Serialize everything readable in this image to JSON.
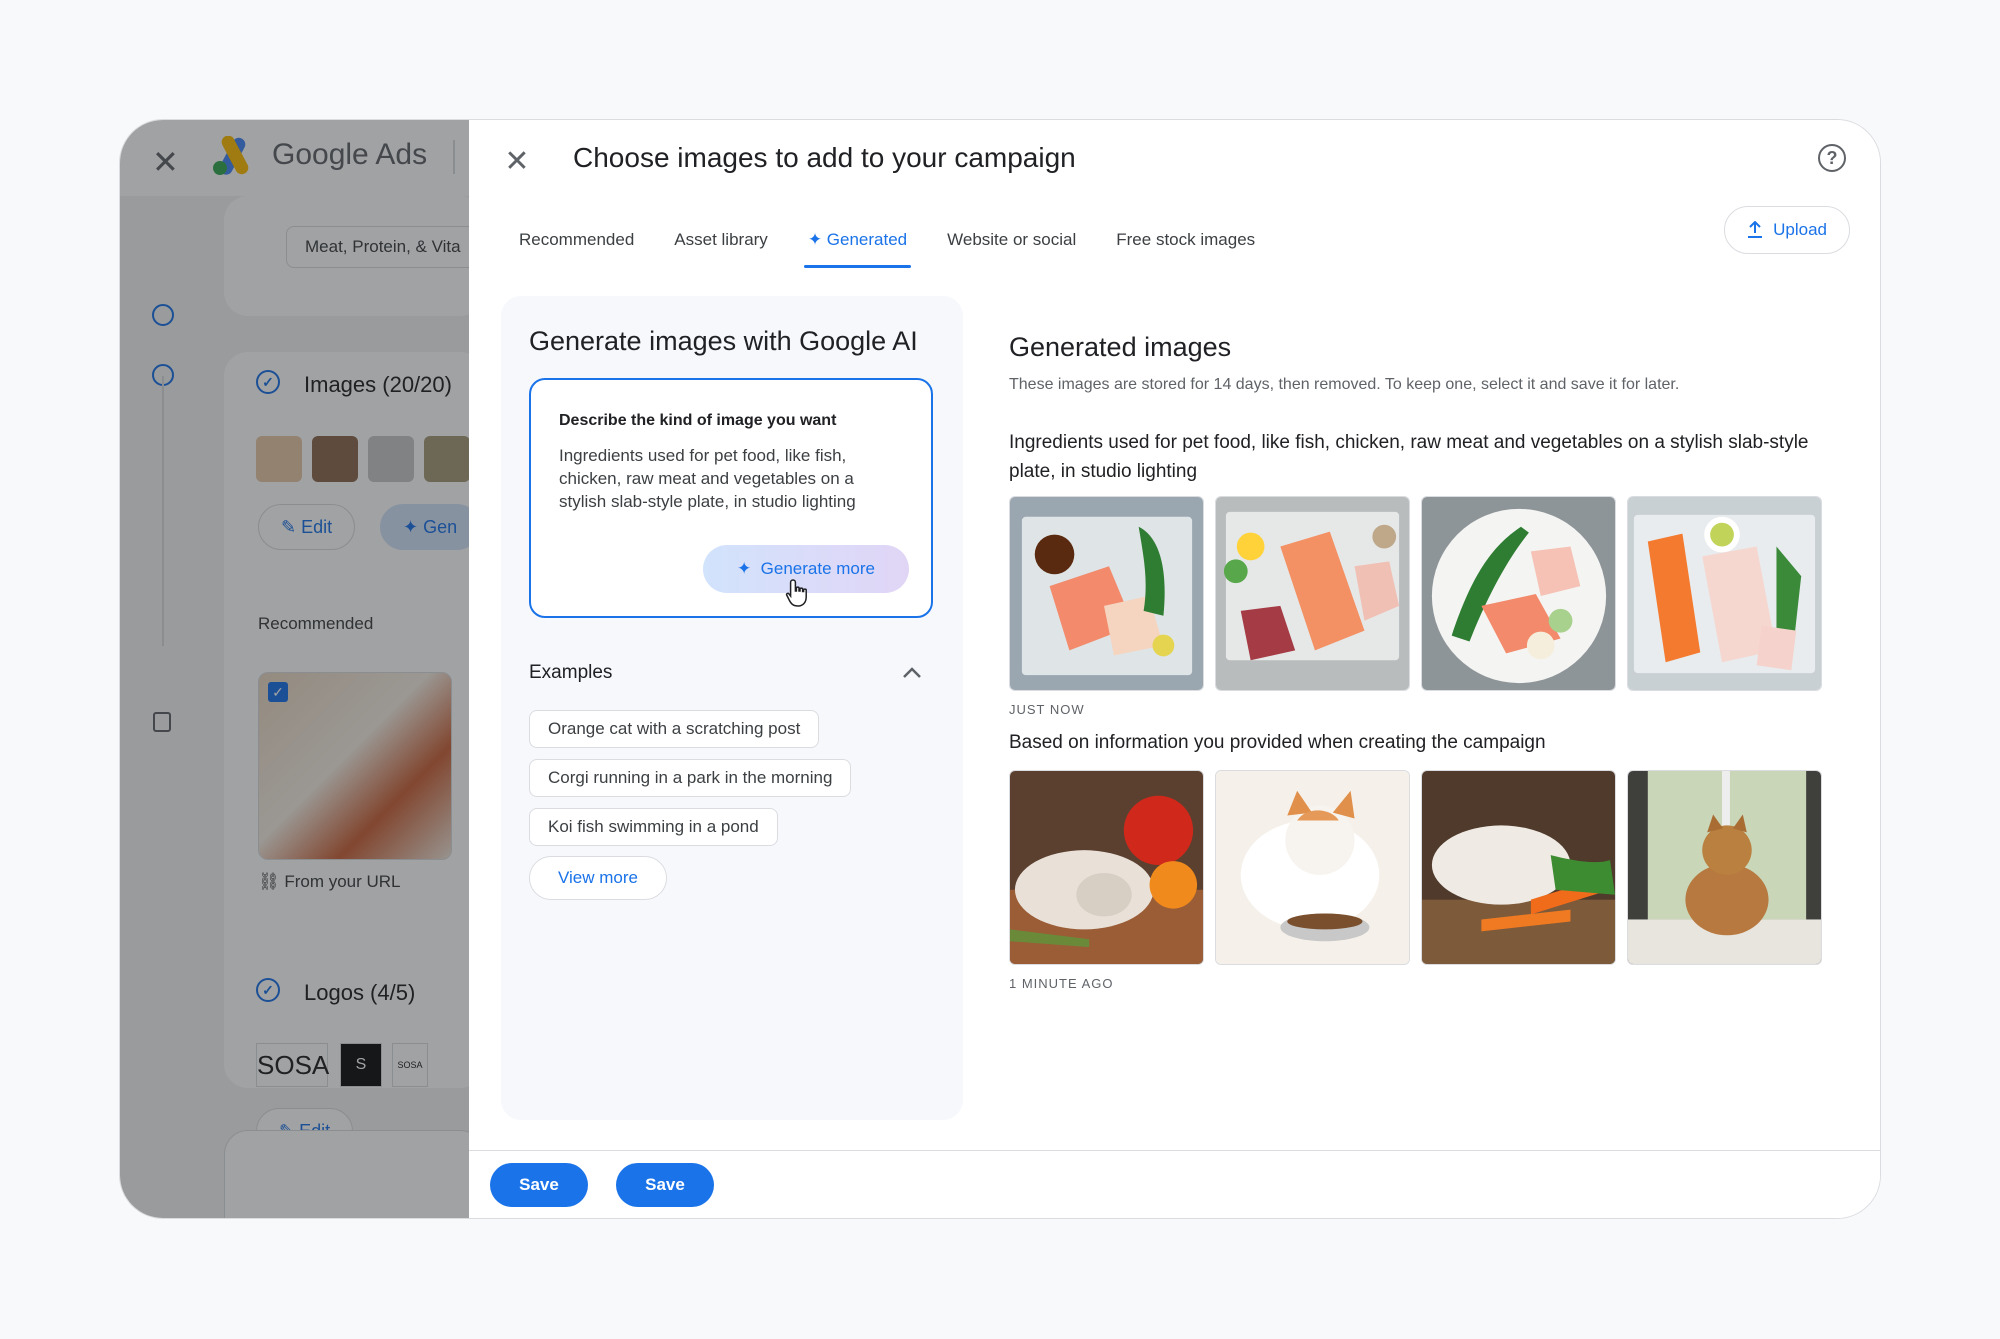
{
  "background_app": {
    "app_name": "Google Ads",
    "filter_chip": "Meat, Protein, & Vita",
    "images_section_title": "Images (20/20)",
    "edit_label": "Edit",
    "generate_label": "Gen",
    "recommended_label": "Recommended",
    "from_url_label": "From your URL",
    "logos_section_title": "Logos (4/5)",
    "logo_text": "SOSA",
    "logo_dark_text": "S",
    "logo_small_text": "SOSA",
    "edit_label_2": "Edit"
  },
  "dialog": {
    "title": "Choose images to add to your campaign",
    "tabs": [
      {
        "label": "Recommended"
      },
      {
        "label": "Asset library"
      },
      {
        "label": "✦ Generated"
      },
      {
        "label": "Website or social"
      },
      {
        "label": "Free stock images"
      }
    ],
    "active_tab": "Generated",
    "upload_label": "Upload",
    "footer": {
      "save_label_1": "Save",
      "save_label_2": "Save"
    }
  },
  "generator": {
    "title": "Generate images with Google AI",
    "prompt_label": "Describe the kind of image you want",
    "prompt_text": "Ingredients used for pet food, like fish, chicken, raw meat and vegetables on a stylish slab-style plate, in studio lighting",
    "generate_more_label": "Generate more",
    "examples_heading": "Examples",
    "examples": [
      "Orange cat with a scratching post",
      "Corgi running in a park in the morning",
      "Koi fish swimming in a pond"
    ],
    "view_more_label": "View more"
  },
  "results": {
    "title": "Generated images",
    "subtitle": "These images are stored for 14 days, then removed. To keep one, select it and save it for later.",
    "groups": [
      {
        "heading": "Ingredients used for pet food, like fish, chicken, raw meat and vegetables on a stylish slab-style plate, in studio lighting",
        "timestamp": "JUST NOW",
        "images": [
          "salmon-and-chicken-on-slab",
          "salmon-and-raw-meat-on-slab",
          "salmon-on-round-plate",
          "salmon-and-chicken-with-greens"
        ]
      },
      {
        "heading": "Based on information you provided when creating the campaign",
        "timestamp": "1 MINUTE AGO",
        "images": [
          "cat-sleeping-with-vegetables",
          "cat-eating-from-bowl",
          "cat-sleeping-with-carrots",
          "cat-looking-out-window"
        ]
      }
    ]
  },
  "colors": {
    "accent": "#1a73e8",
    "panel_bg": "#f6f8fc",
    "border": "#dadce0"
  }
}
